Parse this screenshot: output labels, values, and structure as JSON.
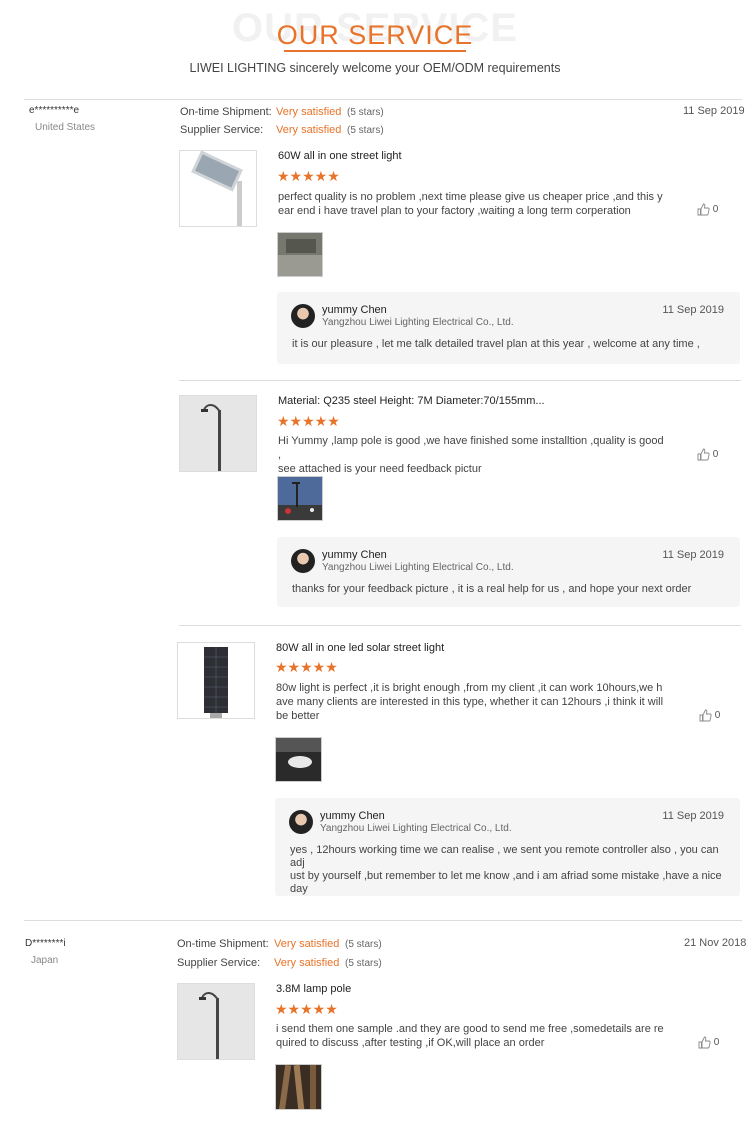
{
  "header": {
    "watermark": "OUR SERVICE",
    "title": "OUR SERVICE",
    "subtitle": "LIWEI LIGHTING sincerely welcome your OEM/ODM requirements"
  },
  "colors": {
    "accent": "#e8732a"
  },
  "like_icon": "thumbs-up-icon",
  "buyers": [
    {
      "name": "e**********e",
      "country": "United States",
      "ratings": [
        {
          "label": "On-time Shipment:",
          "value": "Very satisfied",
          "stars": "(5 stars)"
        },
        {
          "label": "Supplier Service:",
          "value": "Very satisfied",
          "stars": "(5 stars)"
        }
      ],
      "date": "11 Sep 2019",
      "reviews": [
        {
          "product": "60W all in one street light",
          "rating": "★★★★★",
          "text": [
            "perfect quality is no problem ,next time  please give us cheaper price ,and this y",
            "ear end  i have travel plan to your factory ,waiting a long term corperation"
          ],
          "likes": "0",
          "reply": {
            "name": "yummy Chen",
            "company": "Yangzhou Liwei Lighting Electrical Co., Ltd.",
            "date": "11 Sep 2019",
            "text": [
              "it is our pleasure , let me talk detailed travel plan at this year , welcome at any time ,"
            ]
          }
        },
        {
          "product": "Material: Q235 steel Height: 7M Diameter:70/155mm...",
          "rating": "★★★★★",
          "text": [
            "Hi Yummy ,lamp pole is good ,we have finished some installtion ,quality is good ,",
            "see attached is your need feedback pictur"
          ],
          "likes": "0",
          "reply": {
            "name": "yummy Chen",
            "company": "Yangzhou Liwei Lighting Electrical Co., Ltd.",
            "date": "11 Sep 2019",
            "text": [
              "thanks for your feedback picture , it is a real help for us , and hope your next order"
            ]
          }
        },
        {
          "product": "80W all in one led solar street light",
          "rating": "★★★★★",
          "text": [
            "80w light is perfect ,it is bright enough ,from my client ,it can work 10hours,we h",
            "ave many clients are interested in this type, whether it can 12hours ,i think it will",
            "be better"
          ],
          "likes": "0",
          "reply": {
            "name": "yummy Chen",
            "company": "Yangzhou Liwei Lighting Electrical Co., Ltd.",
            "date": "11 Sep 2019",
            "text": [
              "yes , 12hours working time we can realise , we sent you remote controller also , you can adj",
              "ust by yourself ,but remember to let me know ,and i am afriad some mistake ,have a nice day"
            ]
          }
        }
      ]
    },
    {
      "name": "D********i",
      "country": "Japan",
      "ratings": [
        {
          "label": "On-time Shipment:",
          "value": "Very satisfied",
          "stars": "(5 stars)"
        },
        {
          "label": "Supplier Service:",
          "value": "Very satisfied",
          "stars": "(5 stars)"
        }
      ],
      "date": "21 Nov 2018",
      "reviews": [
        {
          "product": "3.8M lamp pole",
          "rating": "★★★★★",
          "text": [
            "i send them one sample .and they are good to send me free ,somedetails are re",
            "quired to discuss ,after testing ,if OK,will place an order"
          ],
          "likes": "0"
        }
      ]
    }
  ]
}
